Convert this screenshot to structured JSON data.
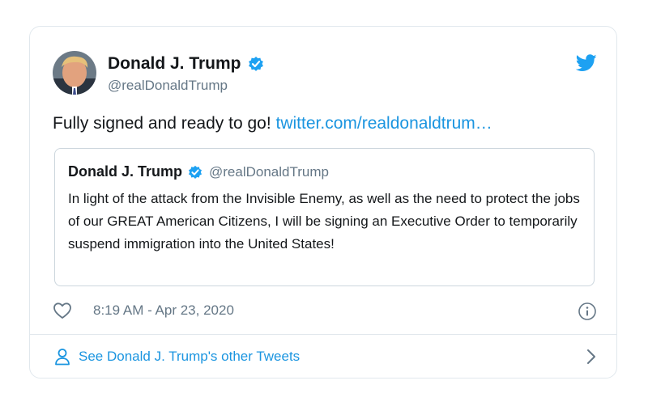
{
  "tweet": {
    "author_name": "Donald J. Trump",
    "author_handle": "@realDonaldTrump",
    "text": "Fully signed and ready to go! ",
    "link_text": "twitter.com/realdonaldtrum…",
    "timestamp": "8:19 AM - Apr 23, 2020"
  },
  "quoted_tweet": {
    "author_name": "Donald J. Trump",
    "author_handle": "@realDonaldTrump",
    "text": "In light of the attack from the Invisible Enemy, as well as the need to protect the jobs of our GREAT American Citizens, I will be signing an Executive Order to temporarily suspend immigration into the United States!"
  },
  "footer": {
    "link_label": "See Donald J. Trump's other Tweets"
  },
  "icons": {
    "verified": "verified-badge-icon",
    "bird": "twitter-bird-icon",
    "heart": "heart-icon",
    "info": "info-icon",
    "person": "person-icon",
    "chevron": "chevron-right-icon"
  },
  "colors": {
    "link": "#1b95e0",
    "verified": "#1da1f2",
    "secondary_text": "#657786",
    "border": "#e1e8ed"
  }
}
